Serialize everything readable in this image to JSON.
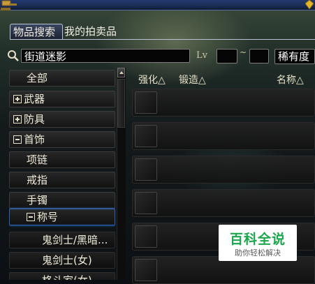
{
  "tabs": {
    "search_label": "物品搜索",
    "my_auctions_label": "我的拍卖品"
  },
  "search": {
    "value": "街道迷影",
    "level_label": "Lv",
    "level_separator": "~",
    "level_min": "",
    "level_max": ""
  },
  "rarity_select": {
    "value": "稀有度"
  },
  "categories": [
    {
      "label": "全部",
      "type": "leaf"
    },
    {
      "label": "武器",
      "type": "collapsed"
    },
    {
      "label": "防具",
      "type": "collapsed"
    },
    {
      "label": "首饰",
      "type": "expanded"
    },
    {
      "label": "项链",
      "type": "leaf"
    },
    {
      "label": "戒指",
      "type": "leaf"
    },
    {
      "label": "手镯",
      "type": "leaf"
    },
    {
      "label": "称号",
      "type": "expanded",
      "selected": true
    },
    {
      "label": "鬼剑士/黑暗...",
      "type": "leaf"
    },
    {
      "label": "鬼剑士(女)",
      "type": "leaf"
    },
    {
      "label": "格斗家(女)",
      "type": "leaf"
    }
  ],
  "columns": {
    "enhance": "强化△",
    "forge": "锻造△",
    "name": "名称△"
  },
  "watermark": {
    "title": "百科全说",
    "subtitle": "助你轻松解决"
  },
  "colors": {
    "title_bar": "#1b2c55",
    "selection_border": "#2a64b8",
    "watermark_green": "#1aa64a"
  },
  "icons": [
    "gavel-icon",
    "gem-icon",
    "search-icon",
    "scroll-up-icon"
  ]
}
